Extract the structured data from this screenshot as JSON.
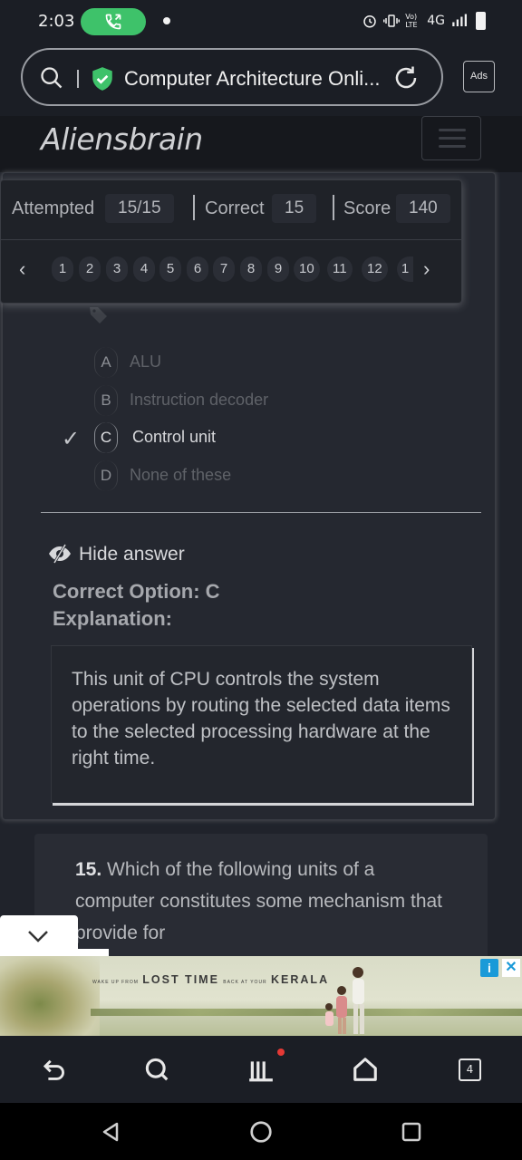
{
  "status_bar": {
    "time": "2:03",
    "network": "4G",
    "volte": "Vo) LTE"
  },
  "browser": {
    "url_title": "Computer Architecture Onli...",
    "ads_label": "Ads"
  },
  "site": {
    "brand": "Aliensbrain"
  },
  "stats": {
    "attempted_label": "Attempted",
    "attempted_value": "15/15",
    "correct_label": "Correct",
    "correct_value": "15",
    "score_label": "Score",
    "score_value": "140"
  },
  "pager": {
    "prev": "‹",
    "next": "›",
    "pages": [
      "1",
      "2",
      "3",
      "4",
      "5",
      "6",
      "7",
      "8",
      "9",
      "10",
      "11",
      "12",
      "1"
    ]
  },
  "question": {
    "options": [
      {
        "letter": "A",
        "text": "ALU",
        "correct": false
      },
      {
        "letter": "B",
        "text": "Instruction decoder",
        "correct": false
      },
      {
        "letter": "C",
        "text": "Control unit",
        "correct": true
      },
      {
        "letter": "D",
        "text": "None of these",
        "correct": false
      }
    ],
    "check_mark": "✓",
    "hide_answer_label": "Hide answer",
    "correct_option_text": "Correct Option: C",
    "explanation_label": "Explanation:",
    "explanation_text": "This unit of CPU controls the system operations by routing the selected data items to the selected processing hardware at the right time."
  },
  "next_question": {
    "number": "15.",
    "text": " Which of the following units of a computer constitutes some mechanism that provide for"
  },
  "ad": {
    "small_left": "WAKE UP FROM",
    "lost_time": "LOST TIME",
    "small_mid": "BACK AT YOUR",
    "kerala": "KERALA",
    "info_label": "i",
    "close_label": "✕"
  },
  "tab_count": "4",
  "colors": {
    "accent_green": "#3ec26a",
    "background": "#20232b",
    "ad_info_blue": "#1a9ad8",
    "notification_red": "#e53935"
  }
}
